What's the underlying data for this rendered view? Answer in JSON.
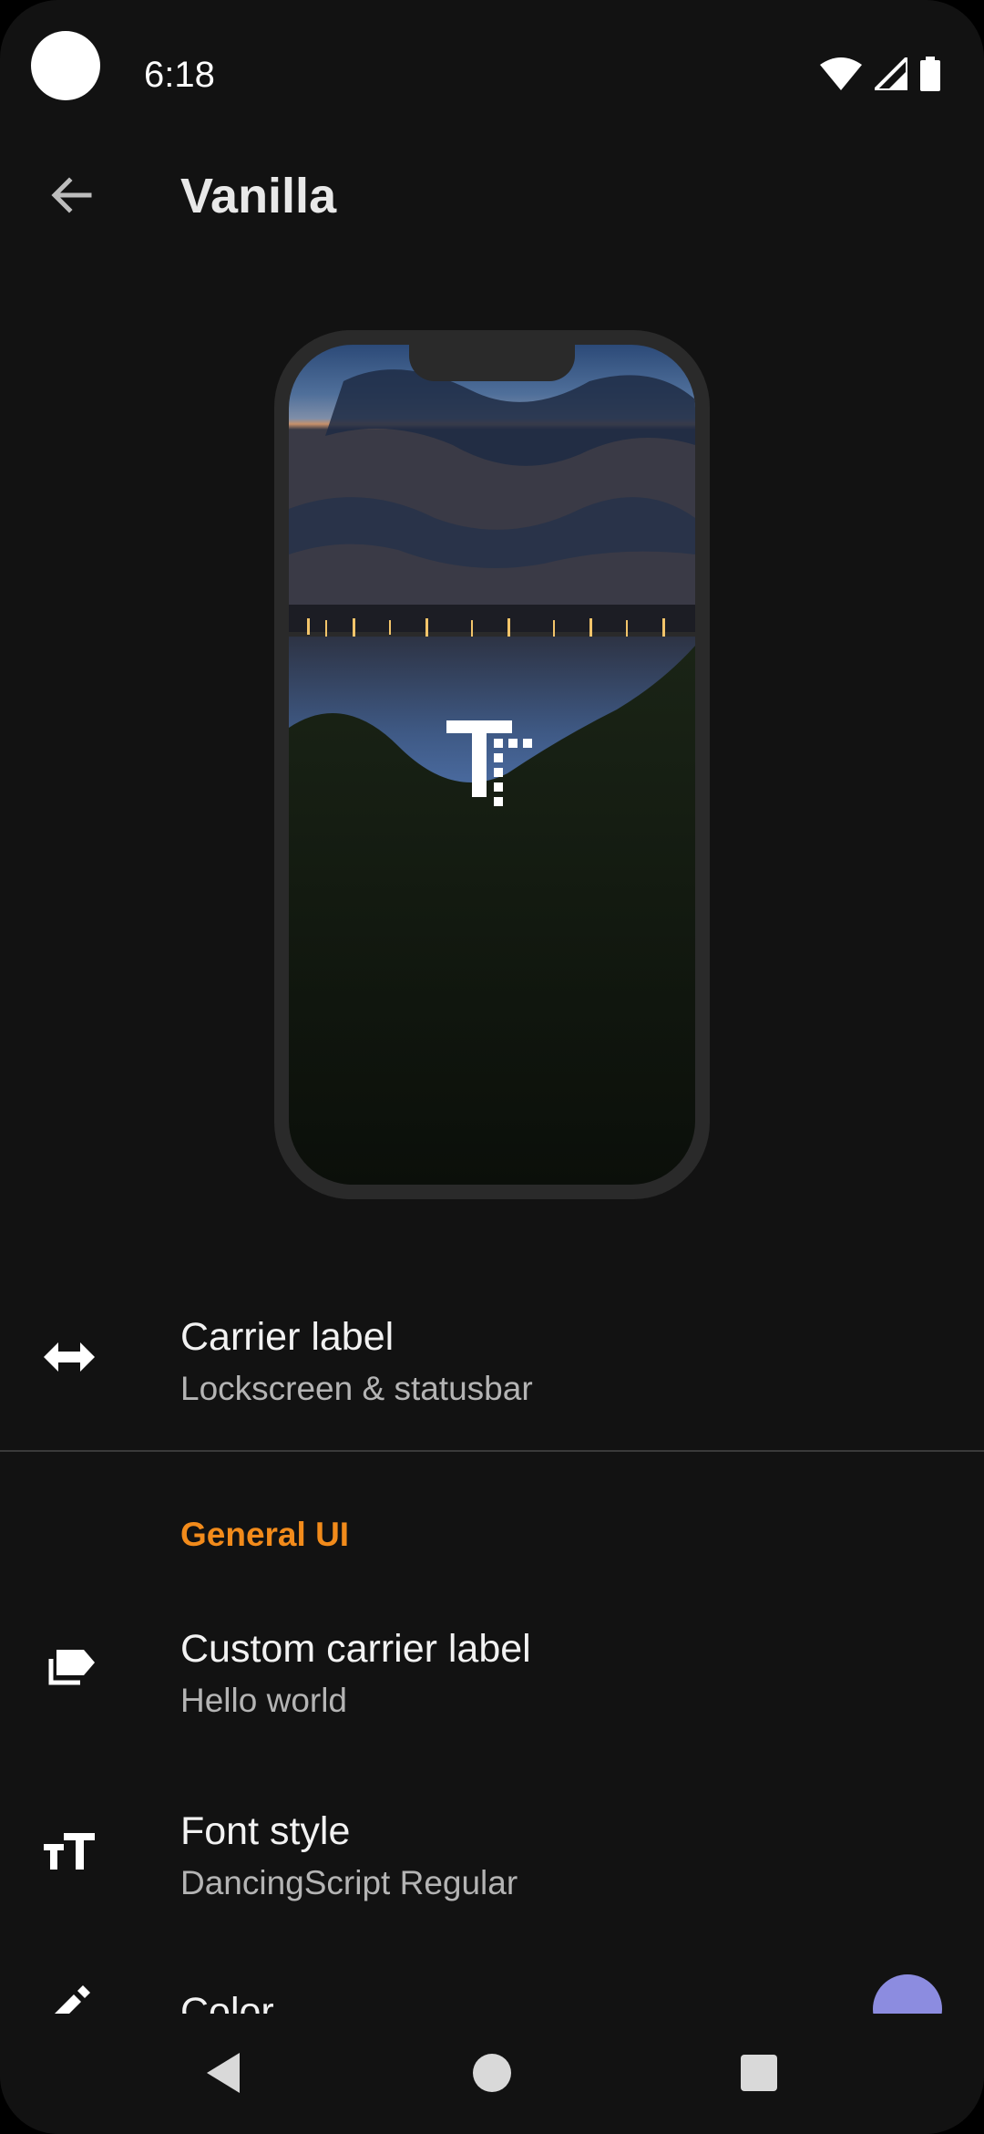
{
  "status_bar": {
    "time": "6:18"
  },
  "app_bar": {
    "title": "Vanilla"
  },
  "settings": {
    "carrier_label": {
      "title": "Carrier label",
      "subtitle": "Lockscreen & statusbar"
    },
    "section_general": "General UI",
    "custom_carrier_label": {
      "title": "Custom carrier label",
      "subtitle": "Hello world"
    },
    "font_style": {
      "title": "Font style",
      "subtitle": "DancingScript Regular"
    },
    "color": {
      "title": "Color",
      "swatch": "#8c8ce0"
    }
  },
  "colors": {
    "background": "#121212",
    "accent": "#f28b1b"
  },
  "icons": {
    "back": "arrow-left-icon",
    "carrier": "swap-horiz-icon",
    "custom_label": "label-icon",
    "font": "text-size-icon",
    "color": "pencil-icon"
  }
}
